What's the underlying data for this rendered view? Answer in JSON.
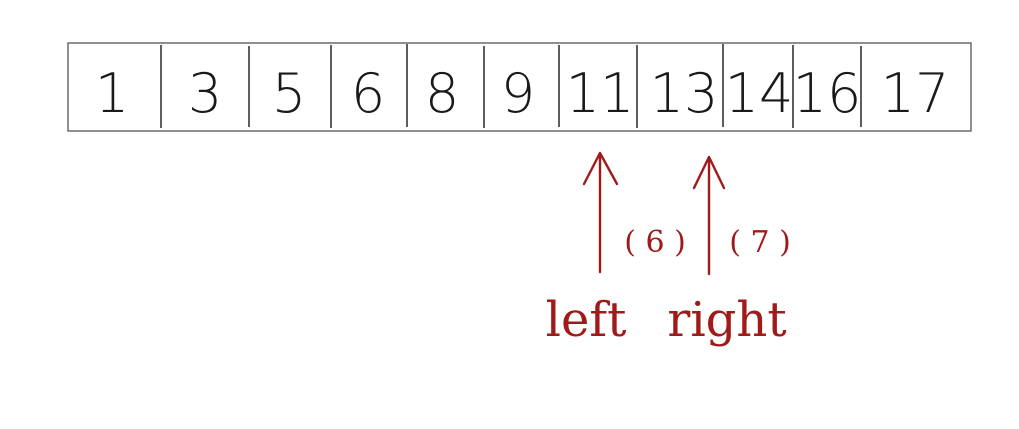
{
  "array": {
    "values": [
      "1",
      "3",
      "5",
      "6",
      "8",
      "9",
      "11",
      "13",
      "14",
      "16",
      "17"
    ],
    "ink_color": "#1a1a1a",
    "border_color": "#555555"
  },
  "pointers": {
    "color": "#a11a1a",
    "left": {
      "label": "left",
      "index_text": "( 6 )"
    },
    "right": {
      "label": "right",
      "index_text": "( 7 )"
    }
  }
}
